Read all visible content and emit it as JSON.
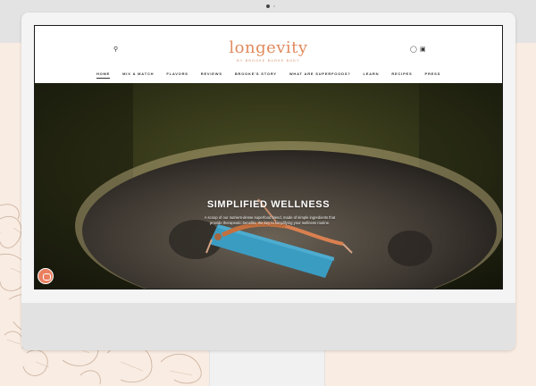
{
  "brand": {
    "logo_text": "longevity",
    "tagline": "BY BROOKE BURKE BODY",
    "accent_color": "#e08a5c"
  },
  "header": {
    "search_icon": "search-icon",
    "account_icon": "user-icon",
    "cart_icon": "cart-icon"
  },
  "nav": {
    "items": [
      {
        "label": "HOME",
        "active": true
      },
      {
        "label": "MIX & MATCH",
        "active": false
      },
      {
        "label": "FLAVORS",
        "active": false
      },
      {
        "label": "REVIEWS",
        "active": false
      },
      {
        "label": "BROOKE'S STORY",
        "active": false
      },
      {
        "label": "WHAT ARE SUPERFOODS?",
        "active": false
      },
      {
        "label": "LEARN",
        "active": false
      },
      {
        "label": "RECIPES",
        "active": false
      },
      {
        "label": "PRESS",
        "active": false
      }
    ]
  },
  "hero": {
    "title": "SIMPLIFIED WELLNESS",
    "text": "A scoop of our nutrient-dense superfood blend, made of simple ingredients that provide therapeutic benefits, the key to simplifying your wellness routine."
  },
  "chat": {
    "icon": "chat-icon",
    "color": "#ea8060"
  }
}
